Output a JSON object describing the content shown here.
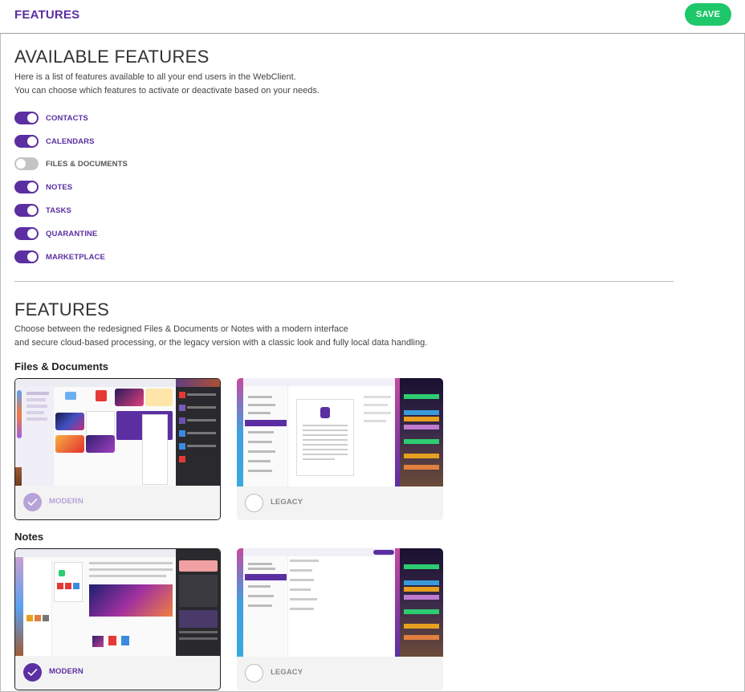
{
  "header": {
    "title": "FEATURES",
    "save_label": "SAVE"
  },
  "available": {
    "title": "AVAILABLE FEATURES",
    "line1": "Here is a list of features available to all your end users in the WebClient.",
    "line2": "You can choose which features to activate or deactivate based on your needs.",
    "toggles": [
      {
        "label": "CONTACTS",
        "enabled": true
      },
      {
        "label": "CALENDARS",
        "enabled": true
      },
      {
        "label": "FILES & DOCUMENTS",
        "enabled": false
      },
      {
        "label": "NOTES",
        "enabled": true
      },
      {
        "label": "TASKS",
        "enabled": true
      },
      {
        "label": "QUARANTINE",
        "enabled": true
      },
      {
        "label": "MARKETPLACE",
        "enabled": true
      }
    ]
  },
  "features": {
    "title": "FEATURES",
    "line1": "Choose between the redesigned Files & Documents or Notes with a modern interface",
    "line2": "and secure cloud-based processing, or the legacy version with a classic look and fully local data handling.",
    "files": {
      "heading": "Files & Documents",
      "modern_label": "MODERN",
      "legacy_label": "LEGACY",
      "selected": "modern",
      "disabled": true
    },
    "notes": {
      "heading": "Notes",
      "modern_label": "MODERN",
      "legacy_label": "LEGACY",
      "selected": "modern",
      "disabled": false
    }
  },
  "colors": {
    "accent": "#5b2fa1",
    "save": "#1ec86a",
    "toggle_off": "#c4c4c4"
  }
}
